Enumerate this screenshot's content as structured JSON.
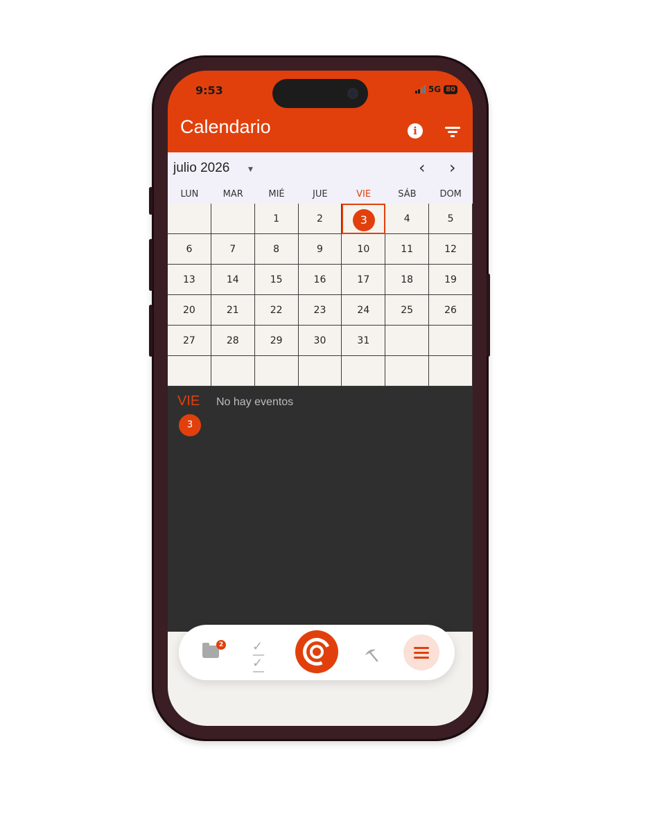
{
  "status": {
    "time": "9:53",
    "network": "5G",
    "battery": "80"
  },
  "header": {
    "title": "Calendario",
    "info_icon": "info-icon",
    "filter_icon": "filter-icon"
  },
  "calendar": {
    "month_label": "julio 2026",
    "weekdays": [
      "LUN",
      "MAR",
      "MIÉ",
      "JUE",
      "VIE",
      "SÁB",
      "DOM"
    ],
    "active_weekday_index": 4,
    "selected_day": "3",
    "weeks": [
      [
        "",
        "",
        "1",
        "2",
        "3",
        "4",
        "5"
      ],
      [
        "6",
        "7",
        "8",
        "9",
        "10",
        "11",
        "12"
      ],
      [
        "13",
        "14",
        "15",
        "16",
        "17",
        "18",
        "19"
      ],
      [
        "20",
        "21",
        "22",
        "23",
        "24",
        "25",
        "26"
      ],
      [
        "27",
        "28",
        "29",
        "30",
        "31",
        "",
        ""
      ],
      [
        "",
        "",
        "",
        "",
        "",
        "",
        ""
      ]
    ]
  },
  "events": {
    "day_label": "VIE",
    "day_number": "3",
    "empty_text": "No hay eventos"
  },
  "bottom_nav": {
    "folder_badge": "2"
  },
  "colors": {
    "accent": "#e1400c",
    "dark_bg": "#2f2f2f",
    "calendar_bg": "#f6f3ee"
  }
}
